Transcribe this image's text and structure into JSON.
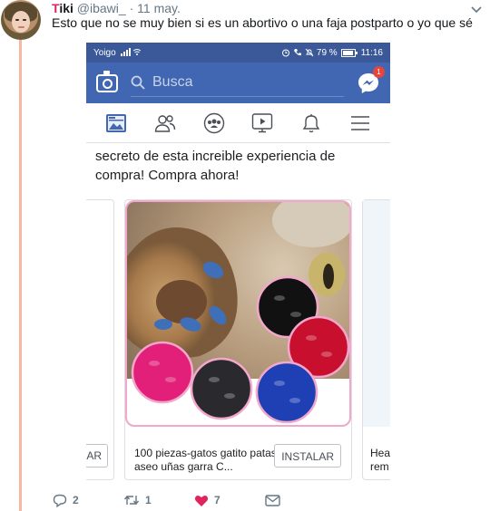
{
  "tweet": {
    "name_first_letter": "T",
    "name_rest": "iki",
    "handle": "@ibawi_",
    "separator": "·",
    "date": "11 may.",
    "text": "Esto que no se muy bien si es un abortivo o una faja postparto o yo que sé"
  },
  "phone": {
    "statusbar": {
      "carrier": "Yoigo",
      "battery_pct": "79 %",
      "time": "11:16"
    },
    "search_placeholder": "Busca",
    "messenger_badge": "1",
    "post_text": "secreto de esta increible experiencia de compra! Compra   ahora!",
    "cards": {
      "left_button": "AR",
      "main_title": "100 piezas-gatos gatito patas aseo uñas garra C...",
      "main_button": "INSTALAR",
      "right_title_line1": "Hea",
      "right_title_line2": "rem"
    }
  },
  "actions": {
    "replies": "2",
    "retweets": "1",
    "likes": "7"
  },
  "colors": {
    "twitter_like": "#e0245e",
    "facebook_blue": "#4267b2",
    "status_blue": "#3b5998",
    "thread_line": "#f6b8a4"
  }
}
